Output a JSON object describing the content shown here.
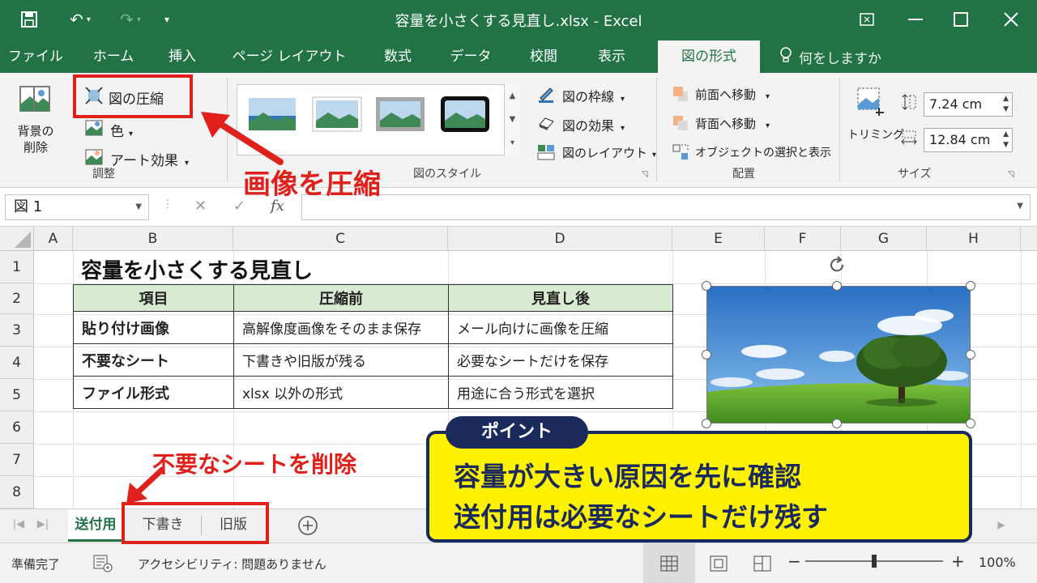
{
  "window": {
    "title": "容量を小さくする見直し.xlsx  -  Excel",
    "minimize_icon": "minimize-icon",
    "maximize_icon": "maximize-icon",
    "close_icon": "close-icon"
  },
  "tabs": [
    "ファイル",
    "ホーム",
    "挿入",
    "ページ レイアウト",
    "数式",
    "データ",
    "校閲",
    "表示",
    "図の形式"
  ],
  "active_tab": "図の形式",
  "tell_me": "何をしますか",
  "ribbon": {
    "remove_background": [
      "背景の",
      "削除"
    ],
    "compress_pictures": "図の圧縮",
    "color": "色",
    "artistic_effects": "アート効果",
    "adjust_group": "調整",
    "picture_border": "図の枠線",
    "picture_effects": "図の効果",
    "picture_layout": "図のレイアウト",
    "styles_group": "図のスタイル",
    "bring_forward": "前面へ移動",
    "send_backward": "背面へ移動",
    "selection_pane": "オブジェクトの選択と表示",
    "arrange_group": "配置",
    "crop": "トリミング",
    "height": "7.24 cm",
    "width": "12.84 cm",
    "size_group": "サイズ"
  },
  "formula_bar": {
    "name_box": "図 1",
    "cancel": "✕",
    "enter": "✓",
    "fx": "fx",
    "value": ""
  },
  "columns": [
    "A",
    "B",
    "C",
    "D",
    "E",
    "F",
    "G",
    "H"
  ],
  "rows": [
    "1",
    "2",
    "3",
    "4",
    "5",
    "6",
    "7",
    "8"
  ],
  "sheet": {
    "title": "容量を小さくする見直し",
    "table_headers": [
      "項目",
      "圧縮前",
      "見直し後"
    ],
    "table_rows": [
      [
        "貼り付け画像",
        "高解像度画像をそのまま保存",
        "メール向けに画像を圧縮"
      ],
      [
        "不要なシート",
        "下書きや旧版が残る",
        "必要なシートだけを保存"
      ],
      [
        "ファイル形式",
        "xlsx 以外の形式",
        "用途に合う形式を選択"
      ]
    ]
  },
  "sheet_tabs": [
    "送付用",
    "下書き",
    "旧版"
  ],
  "active_sheet": "送付用",
  "status": {
    "ready": "準備完了",
    "accessibility": "アクセシビリティ: 問題ありません",
    "zoom": "100%",
    "zoom_minus": "−",
    "zoom_plus": "+"
  },
  "annotations": {
    "compress_callout": "画像を圧縮",
    "delete_callout": "不要なシートを削除",
    "point_tag": "ポイント",
    "point_line1": "容量が大きい原因を先に確認",
    "point_line2": "送付用は必要なシートだけ残す"
  },
  "colors": {
    "excel_green": "#217346",
    "annotation_red": "#e0201b",
    "point_yellow": "#fff200",
    "point_navy": "#1b2a5c",
    "header_fill": "#d9ead3"
  }
}
